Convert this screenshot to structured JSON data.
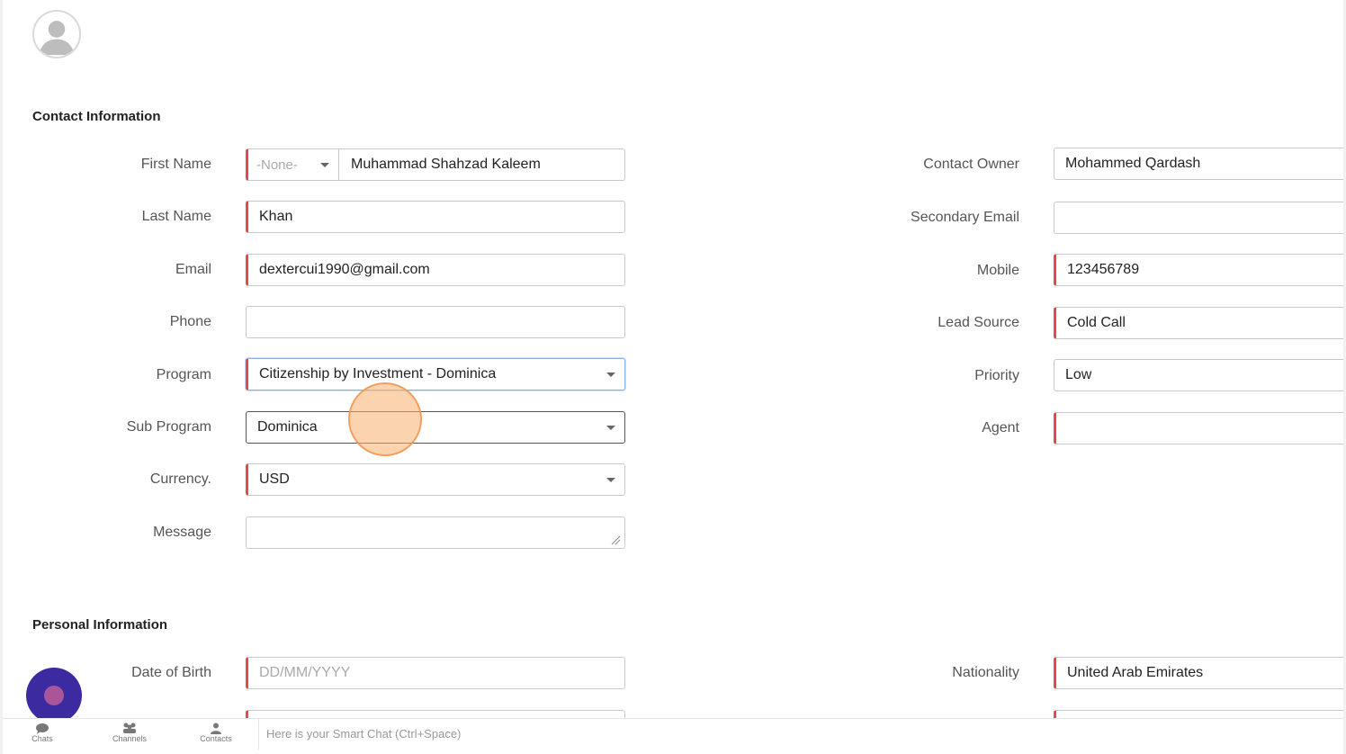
{
  "contact_section": {
    "title": "Contact Information",
    "first_name": {
      "label": "First Name",
      "salutation": "-None-",
      "value": "Muhammad Shahzad Kaleem"
    },
    "last_name": {
      "label": "Last Name",
      "value": "Khan"
    },
    "email": {
      "label": "Email",
      "value": "dextercui1990@gmail.com"
    },
    "phone": {
      "label": "Phone",
      "value": ""
    },
    "program": {
      "label": "Program",
      "value": "Citizenship by Investment - Dominica"
    },
    "sub_program": {
      "label": "Sub Program",
      "value": "Dominica"
    },
    "currency": {
      "label": "Currency.",
      "value": "USD"
    },
    "message": {
      "label": "Message",
      "value": ""
    },
    "contact_owner": {
      "label": "Contact Owner",
      "value": "Mohammed Qardash"
    },
    "secondary_email": {
      "label": "Secondary Email",
      "value": ""
    },
    "mobile": {
      "label": "Mobile",
      "value": "123456789"
    },
    "lead_source": {
      "label": "Lead Source",
      "value": "Cold Call"
    },
    "priority": {
      "label": "Priority",
      "value": "Low"
    },
    "agent": {
      "label": "Agent",
      "value": ""
    }
  },
  "personal_section": {
    "title": "Personal Information",
    "dob": {
      "label": "Date of Birth",
      "placeholder": "DD/MM/YYYY"
    },
    "nationality": {
      "label": "Nationality",
      "value": "United Arab Emirates"
    }
  },
  "bottom_bar": {
    "chats": "Chats",
    "channels": "Channels",
    "contacts": "Contacts",
    "smart_chat_placeholder": "Here is your Smart Chat (Ctrl+Space)"
  },
  "colors": {
    "required_marker": "#e04b4b",
    "fab": "#3c2aa0",
    "click_marker": "#f5a261"
  }
}
